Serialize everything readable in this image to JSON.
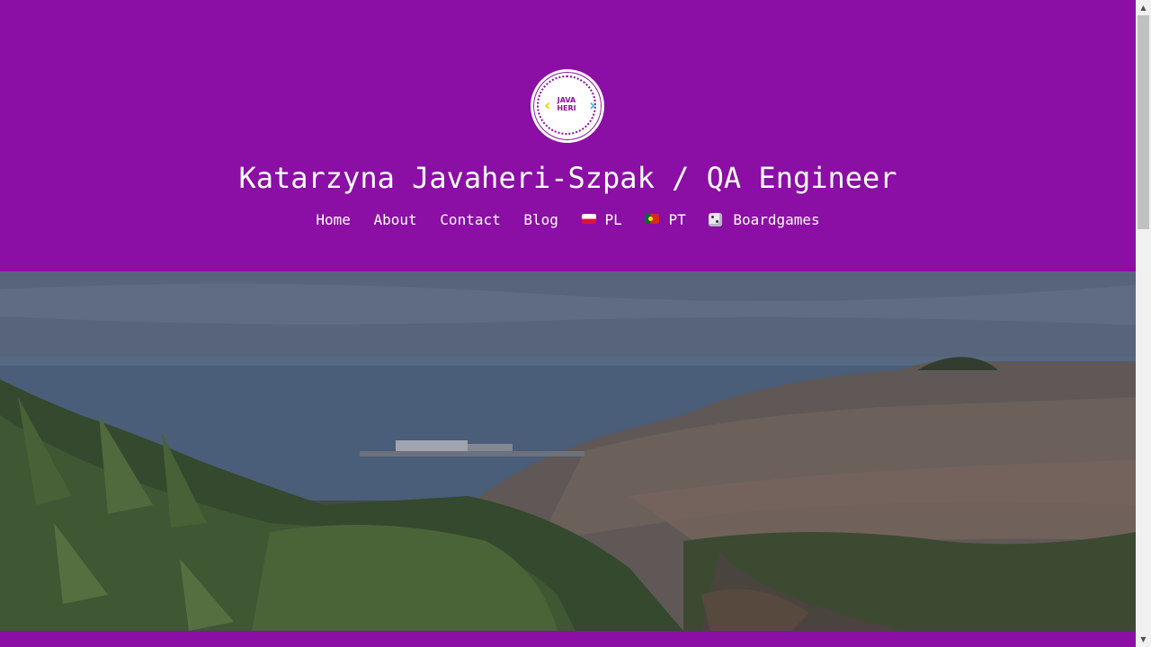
{
  "site": {
    "title": "Katarzyna Javaheri-Szpak / QA Engineer",
    "logo_text_line1": "JAVA",
    "logo_text_line2": "HERI"
  },
  "nav": {
    "items": [
      {
        "label": "Home"
      },
      {
        "label": "About"
      },
      {
        "label": "Contact"
      },
      {
        "label": "Blog"
      },
      {
        "label": "PL",
        "icon": "flag-poland-icon"
      },
      {
        "label": "PT",
        "icon": "flag-portugal-icon"
      },
      {
        "label": "Boardgames",
        "icon": "dice-icon"
      }
    ]
  },
  "colors": {
    "accent": "#8b0ea5",
    "text": "#ffffff"
  },
  "hero": {
    "icon": "landscape-photo"
  }
}
